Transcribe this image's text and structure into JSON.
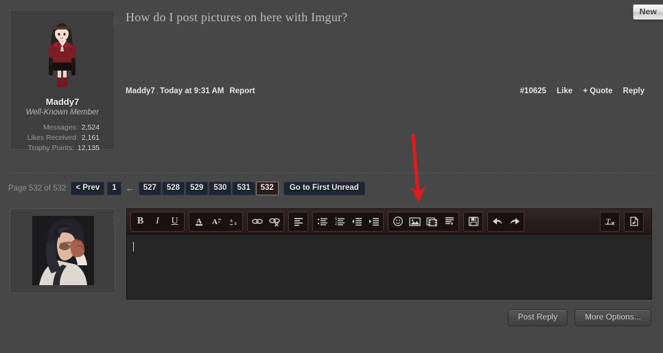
{
  "badge": {
    "label": "New"
  },
  "post": {
    "title": "How do I post pictures on here with Imgur?",
    "author": "Maddy7",
    "timestamp": "Today at 9:31 AM",
    "report_label": "Report",
    "post_id": "#10625",
    "like_label": "Like",
    "quote_label": "+ Quote",
    "reply_label": "Reply",
    "user": {
      "name": "Maddy7",
      "title": "Well-Known Member",
      "stats": [
        {
          "label": "Messages:",
          "value": "2,524"
        },
        {
          "label": "Likes Received:",
          "value": "2,161"
        },
        {
          "label": "Trophy Points:",
          "value": "12,135"
        }
      ],
      "avatar_icon": "anime-character-avatar"
    }
  },
  "pagenav": {
    "page_text": "Page 532 of 532",
    "prev_label": "< Prev",
    "first_page": "1",
    "ellipsis_arrow": "←",
    "pages": [
      "527",
      "528",
      "529",
      "530",
      "531",
      "532"
    ],
    "current_page": "532",
    "unread_label": "Go to First Unread"
  },
  "reply": {
    "avatar_icon": "user-photo-avatar",
    "editor_placeholder": "",
    "editor_value": "",
    "toolbar_groups": [
      {
        "name": "text-style",
        "buttons": [
          {
            "name": "bold-icon",
            "label": "B",
            "kind": "bold"
          },
          {
            "name": "italic-icon",
            "label": "I",
            "kind": "ital"
          },
          {
            "name": "underline-icon",
            "label": "U",
            "kind": "under"
          }
        ]
      },
      {
        "name": "font-color",
        "buttons": [
          {
            "name": "text-color-icon",
            "label": "",
            "kind": "svg-color"
          },
          {
            "name": "font-size-icon",
            "label": "",
            "kind": "svg-size"
          },
          {
            "name": "font-family-icon",
            "label": "",
            "kind": "svg-family"
          }
        ]
      },
      {
        "name": "link",
        "buttons": [
          {
            "name": "insert-link-icon",
            "label": "",
            "kind": "svg-link"
          },
          {
            "name": "remove-link-icon",
            "label": "",
            "kind": "svg-unlink"
          }
        ]
      },
      {
        "name": "align",
        "buttons": [
          {
            "name": "align-left-icon",
            "label": "",
            "kind": "svg-align"
          }
        ]
      },
      {
        "name": "lists",
        "buttons": [
          {
            "name": "bullet-list-icon",
            "label": "",
            "kind": "svg-ul"
          },
          {
            "name": "numbered-list-icon",
            "label": "",
            "kind": "svg-ol"
          },
          {
            "name": "outdent-icon",
            "label": "",
            "kind": "svg-outdent"
          },
          {
            "name": "indent-icon",
            "label": "",
            "kind": "svg-indent"
          }
        ]
      },
      {
        "name": "media",
        "buttons": [
          {
            "name": "smilie-icon",
            "label": "",
            "kind": "svg-smiley"
          },
          {
            "name": "insert-image-icon",
            "label": "",
            "kind": "svg-image"
          },
          {
            "name": "insert-media-icon",
            "label": "",
            "kind": "svg-media"
          },
          {
            "name": "insert-quote-icon",
            "label": "",
            "kind": "svg-quote"
          }
        ]
      },
      {
        "name": "draft",
        "buttons": [
          {
            "name": "save-draft-icon",
            "label": "",
            "kind": "svg-floppy"
          }
        ]
      },
      {
        "name": "history",
        "buttons": [
          {
            "name": "undo-icon",
            "label": "",
            "kind": "svg-undo"
          },
          {
            "name": "redo-icon",
            "label": "",
            "kind": "svg-redo"
          }
        ]
      },
      {
        "name": "format-tools",
        "buttons": [
          {
            "name": "remove-formatting-icon",
            "label": "",
            "kind": "svg-tx"
          }
        ]
      },
      {
        "name": "source-view",
        "buttons": [
          {
            "name": "toggle-bbcode-icon",
            "label": "",
            "kind": "svg-bbcode"
          }
        ]
      }
    ],
    "post_reply_label": "Post Reply",
    "more_options_label": "More Options..."
  },
  "annotation": {
    "name": "red-arrow-pointing-to-image-button",
    "color": "#e01b1b"
  }
}
